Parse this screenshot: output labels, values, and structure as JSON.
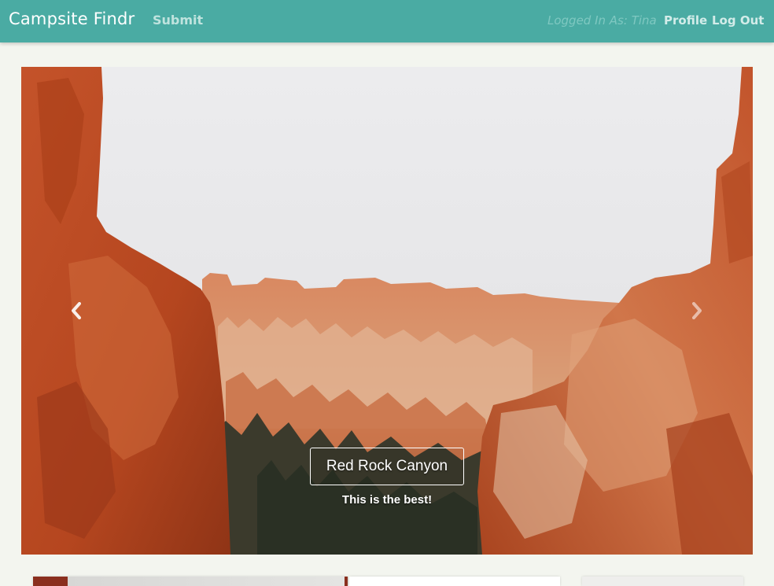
{
  "navbar": {
    "brand": "Campsite Findr",
    "submit_label": "Submit",
    "logged_in_text": "Logged In As: Tina",
    "profile_label": "Profile",
    "logout_label": "Log Out",
    "color": "#4aaba3"
  },
  "carousel": {
    "caption_title": "Red Rock Canyon",
    "caption_subtitle": "This is the best!",
    "prev_icon": "chevron-left-icon",
    "next_icon": "chevron-right-icon"
  }
}
